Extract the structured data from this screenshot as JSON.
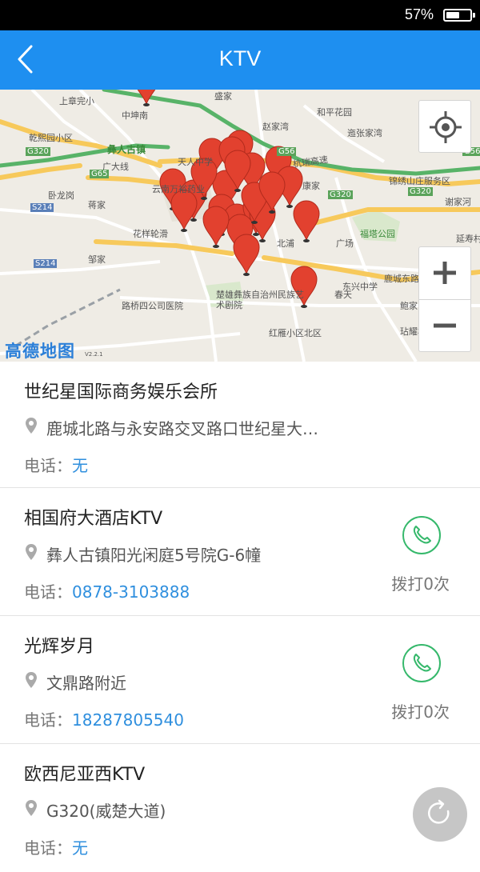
{
  "status": {
    "battery": "57%",
    "battery_level": 0.57
  },
  "header": {
    "title": "KTV",
    "back_icon": "chevron-left-icon"
  },
  "map": {
    "logo": "高德地图",
    "version": "V2.2.1",
    "labels": {
      "l1": "上章完小",
      "l2": "中坤南",
      "l3": "盛家",
      "l4": "和平花园",
      "l5": "赵家湾",
      "l6": "迤张家湾",
      "l7": "乾熙园小区",
      "l8": "彝人古镇",
      "l9": "天人中学",
      "l10": "杭瑞高速",
      "l11": "G56",
      "l12": "广大线",
      "l13": "云南万裕药业",
      "l14": "卧龙岗",
      "l15": "蒋家",
      "l16": "锦绣山庄服务区",
      "l17": "康家",
      "l18": "G320",
      "l19": "谢家河",
      "l20": "花样轮滑",
      "l21": "福塔公园",
      "l22": "北浦",
      "l23": "广场",
      "l24": "延寿村",
      "l25": "邹家",
      "l26": "鹿城东路",
      "l27": "东兴中学",
      "l28": "路桥四公司医院",
      "l29": "楚雄彝族自治州民族艺术剧院",
      "l30": "春天",
      "l31": "鲍家",
      "l32": "红雁小区北区",
      "l33": "玷耀村",
      "l34": "G65",
      "l35": "S214",
      "l36": "G320",
      "l37": "G320",
      "l38": "G56",
      "l39": "S214"
    },
    "icons": {
      "locate": "crosshair-icon",
      "zoom_in": "plus-icon",
      "zoom_out": "minus-icon",
      "marker": "map-marker-icon"
    }
  },
  "places": [
    {
      "name": "世纪星国际商务娱乐会所",
      "address": "鹿城北路与永安路交叉路口世纪星大…",
      "phone_label": "电话：",
      "phone": "无",
      "call_count": ""
    },
    {
      "name": "相国府大酒店KTV",
      "address": "彝人古镇阳光闲庭5号院G-6幢",
      "phone_label": "电话：",
      "phone": "0878-3103888",
      "call_count": "拨打0次"
    },
    {
      "name": "光辉岁月",
      "address": "文鼎路附近",
      "phone_label": "电话：",
      "phone": "18287805540",
      "call_count": "拨打0次"
    },
    {
      "name": "欧西尼亚西KTV",
      "address": "G320(威楚大道)",
      "phone_label": "电话：",
      "phone": "无",
      "call_count": ""
    }
  ],
  "fab": {
    "icon": "refresh-icon"
  }
}
